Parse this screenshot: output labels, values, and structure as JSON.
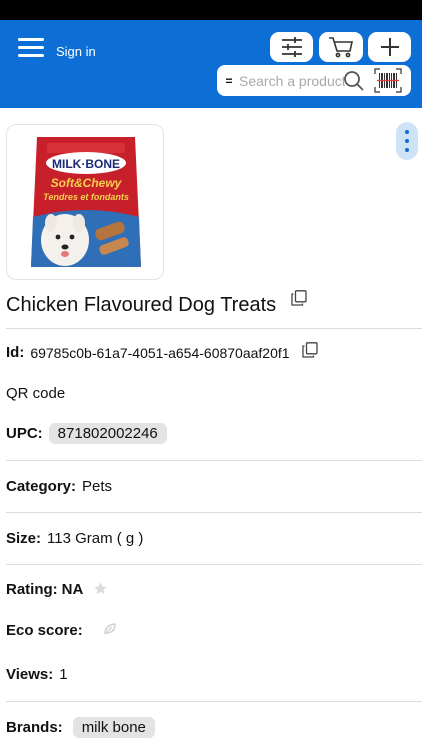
{
  "header": {
    "signin_label": "Sign in",
    "search_placeholder": "Search a product",
    "search_prefix": "="
  },
  "icons": {
    "menu": "hamburger-icon",
    "filter": "sliders-icon",
    "cart": "cart-icon",
    "add": "plus-icon",
    "search": "magnifier-icon",
    "barcode": "barcode-icon",
    "more": "vertical-dots-icon",
    "copy": "copy-icon",
    "rating_star": "star-icon",
    "eco": "leaf-icon"
  },
  "colors": {
    "appbar": "#0d6fd6",
    "chip": "#e3e3e3",
    "more_button": "#cfe3f7"
  },
  "product": {
    "image": {
      "brand_text": "MILK·BONE",
      "line1": "Soft&Chewy",
      "line2": "Tendres et fondants"
    },
    "title": "Chicken Flavoured Dog Treats",
    "id_label": "Id:",
    "id_value": "69785c0b-61a7-4051-a654-60870aaf20f1",
    "qr_label": "QR code",
    "upc_label": "UPC:",
    "upc_value": "871802002246",
    "category_label": "Category:",
    "category_value": "Pets",
    "size_label": "Size:",
    "size_value": "113 Gram ( g )",
    "rating_label": "Rating:",
    "rating_value": "NA",
    "eco_label": "Eco score:",
    "views_label": "Views:",
    "views_value": "1",
    "brands_label": "Brands:",
    "brands_value": "milk bone"
  }
}
